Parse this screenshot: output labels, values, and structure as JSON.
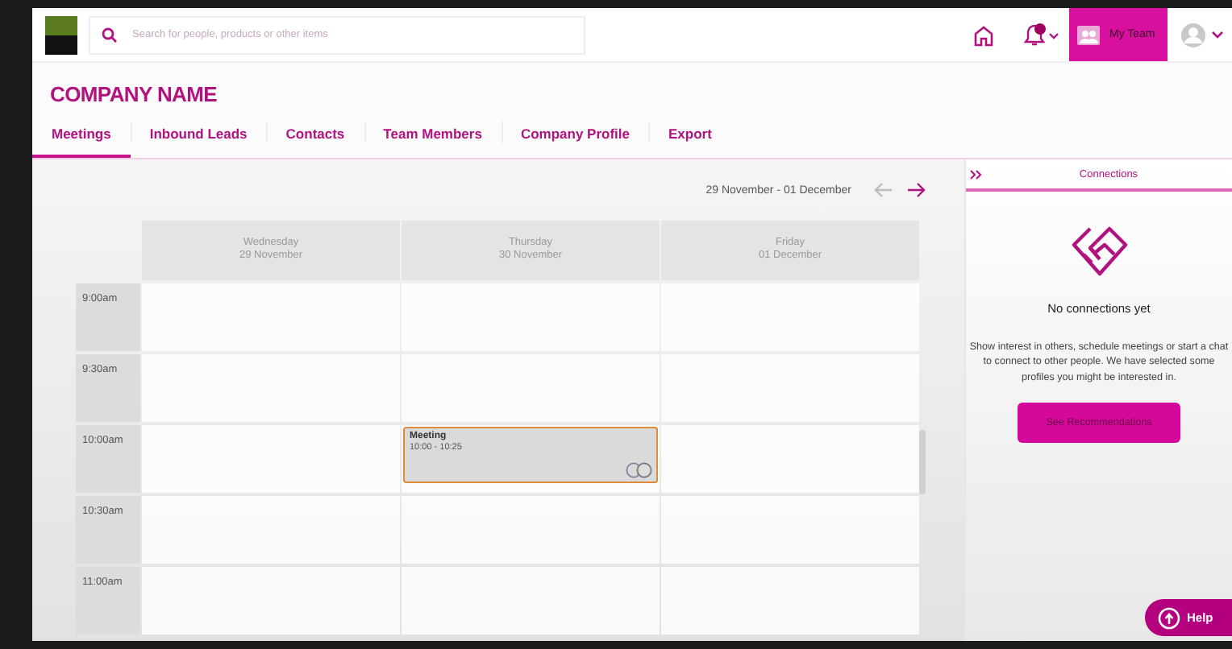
{
  "header": {
    "search": {
      "placeholder": "Search for people, products or other items"
    },
    "notification_badge": true,
    "my_team_button": "My Team"
  },
  "company_name": "COMPANY NAME",
  "tabs": [
    {
      "label": "Meetings",
      "selected": true
    },
    {
      "label": "Inbound Leads",
      "selected": false
    },
    {
      "label": "Contacts",
      "selected": false
    },
    {
      "label": "Team Members",
      "selected": false
    },
    {
      "label": "Company Profile",
      "selected": false
    },
    {
      "label": "Export",
      "selected": false
    }
  ],
  "calendar": {
    "date_range": "29 November - 01 December",
    "days": [
      {
        "weekday": "Wednesday",
        "date": "29 November"
      },
      {
        "weekday": "Thursday",
        "date": "30 November"
      },
      {
        "weekday": "Friday",
        "date": "01 December"
      }
    ],
    "rows": [
      {
        "time": "9:00am"
      },
      {
        "time": "9:30am"
      },
      {
        "time": "10:00am",
        "cells": [
          null,
          {
            "title": "Meeting",
            "time": "10:00 - 10:25"
          },
          null
        ]
      },
      {
        "time": "10:30am"
      },
      {
        "time": "11:00am"
      }
    ]
  },
  "connections": {
    "title": "Connections",
    "empty_title": "No connections yet",
    "message": "Show interest in others, schedule meetings or start a chat to connect to other people. We have selected some profiles you might be interested in.",
    "button": "See Recommendations"
  },
  "help_button": "Help"
}
